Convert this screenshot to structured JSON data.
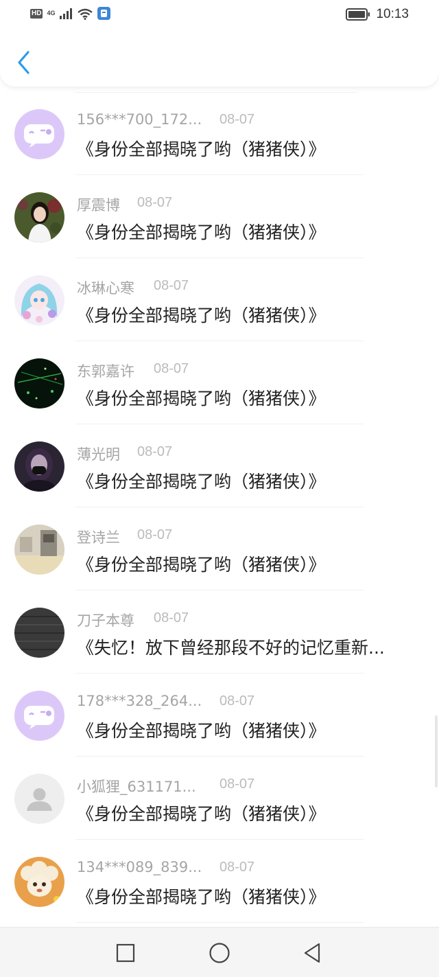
{
  "status_bar": {
    "network_badge": "HD",
    "network_type": "4G",
    "time": "10:13"
  },
  "items": [
    {
      "name": "156***700_172...",
      "date": "08-07",
      "title": "《身份全部揭晓了哟（猪猪侠）》",
      "avatar": "chat-bubble-avatar"
    },
    {
      "name": "厚震博",
      "date": "08-07",
      "title": "《身份全部揭晓了哟（猪猪侠）》",
      "avatar": "girl-photo-avatar"
    },
    {
      "name": "冰琳心寒",
      "date": "08-07",
      "title": "《身份全部揭晓了哟（猪猪侠）》",
      "avatar": "anime-girl-avatar"
    },
    {
      "name": "东郭嘉许",
      "date": "08-07",
      "title": "《身份全部揭晓了哟（猪猪侠）》",
      "avatar": "night-lights-avatar"
    },
    {
      "name": "薄光明",
      "date": "08-07",
      "title": "《身份全部揭晓了哟（猪猪侠）》",
      "avatar": "masked-person-avatar"
    },
    {
      "name": "登诗兰",
      "date": "08-07",
      "title": "《身份全部揭晓了哟（猪猪侠）》",
      "avatar": "room-photo-avatar"
    },
    {
      "name": "刀子本尊",
      "date": "08-07",
      "title": "《失忆！放下曾经那段不好的记忆重新...",
      "avatar": "dark-stripes-avatar"
    },
    {
      "name": "178***328_264...",
      "date": "08-07",
      "title": "《身份全部揭晓了哟（猪猪侠）》",
      "avatar": "chat-bubble-avatar"
    },
    {
      "name": "小狐狸_631171...",
      "date": "08-07",
      "title": "《身份全部揭晓了哟（猪猪侠）》",
      "avatar": "default-user-avatar"
    },
    {
      "name": "134***089_839...",
      "date": "08-07",
      "title": "《身份全部揭晓了哟（猪猪侠）》",
      "avatar": "cartoon-sheep-avatar"
    }
  ],
  "colors": {
    "accent": "#2a9be8",
    "name_text": "#a5a5a5",
    "date_text": "#bbbbbb",
    "title_text": "#222222",
    "chat_avatar_bg": "#d9c3f7"
  }
}
